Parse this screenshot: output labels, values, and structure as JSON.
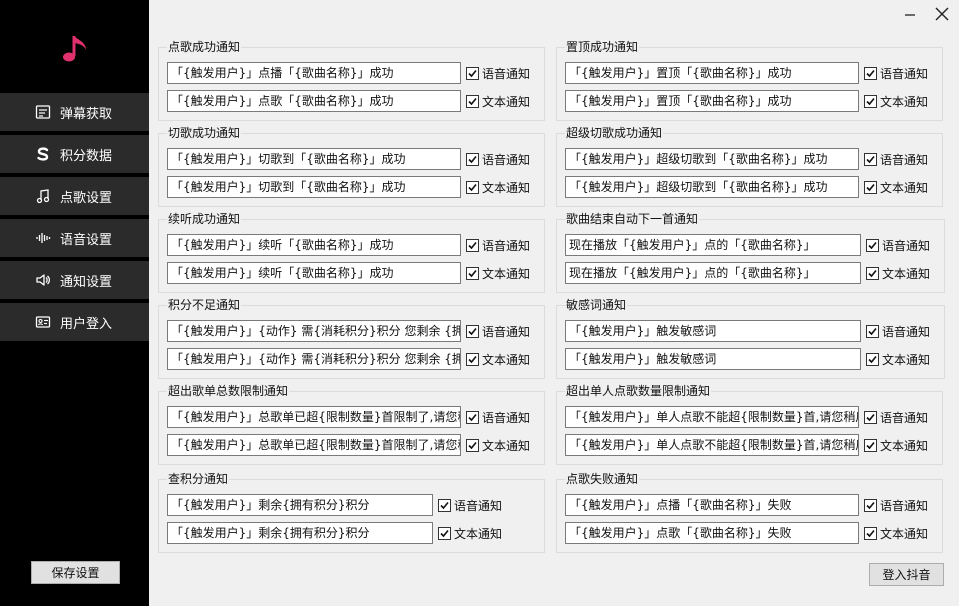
{
  "sidebar": {
    "items": [
      {
        "label": "弹幕获取",
        "icon": "barrage-icon"
      },
      {
        "label": "积分数据",
        "icon": "points-s-icon"
      },
      {
        "label": "点歌设置",
        "icon": "music-note-icon"
      },
      {
        "label": "语音设置",
        "icon": "waveform-icon"
      },
      {
        "label": "通知设置",
        "icon": "speaker-icon"
      },
      {
        "label": "用户登入",
        "icon": "id-card-icon"
      }
    ],
    "save_label": "保存设置"
  },
  "login_label": "登入抖音",
  "labels": {
    "voice": "语音通知",
    "text": "文本通知"
  },
  "colors": {
    "accent": "#e0306e",
    "sidebar_bg": "#000000",
    "nav_bg": "#2b2b2b"
  },
  "groups": [
    {
      "title": "点歌成功通知",
      "voice": "「{触发用户}」点播「{歌曲名称}」成功",
      "text": "「{触发用户}」点歌「{歌曲名称}」成功",
      "voice_checked": true,
      "text_checked": true
    },
    {
      "title": "置顶成功通知",
      "voice": "「{触发用户}」置顶「{歌曲名称}」成功",
      "text": "「{触发用户}」置顶「{歌曲名称}」成功",
      "voice_checked": true,
      "text_checked": true
    },
    {
      "title": "切歌成功通知",
      "voice": "「{触发用户}」切歌到「{歌曲名称}」成功",
      "text": "「{触发用户}」切歌到「{歌曲名称}」成功",
      "voice_checked": true,
      "text_checked": true
    },
    {
      "title": "超级切歌成功通知",
      "voice": "「{触发用户}」超级切歌到「{歌曲名称}」成功",
      "text": "「{触发用户}」超级切歌到「{歌曲名称}」成功",
      "voice_checked": true,
      "text_checked": true
    },
    {
      "title": "续听成功通知",
      "voice": "「{触发用户}」续听「{歌曲名称}」成功",
      "text": "「{触发用户}」续听「{歌曲名称}」成功",
      "voice_checked": true,
      "text_checked": true
    },
    {
      "title": "歌曲结束自动下一首通知",
      "voice": "现在播放「{触发用户}」点的「{歌曲名称}」",
      "text": "现在播放「{触发用户}」点的「{歌曲名称}」",
      "voice_checked": true,
      "text_checked": true
    },
    {
      "title": "积分不足通知",
      "voice": "「{触发用户}」{动作} 需{消耗积分}积分 您剩余 {拥",
      "text": "「{触发用户}」{动作} 需{消耗积分}积分 您剩余 {拥",
      "voice_checked": true,
      "text_checked": true
    },
    {
      "title": "敏感词通知",
      "voice": "「{触发用户}」触发敏感词",
      "text": "「{触发用户}」触发敏感词",
      "voice_checked": true,
      "text_checked": true
    },
    {
      "title": "超出歌单总数限制通知",
      "voice": "「{触发用户}」总歌单已超{限制数量}首限制了,请您稍",
      "text": "「{触发用户}」总歌单已超{限制数量}首限制了,请您稍",
      "voice_checked": true,
      "text_checked": true
    },
    {
      "title": "超出单人点歌数量限制通知",
      "voice": "「{触发用户}」单人点歌不能超{限制数量}首,请您稍后",
      "text": "「{触发用户}」单人点歌不能超{限制数量}首,请您稍后",
      "voice_checked": true,
      "text_checked": true
    },
    {
      "title": "查积分通知",
      "voice": "「{触发用户}」剩余{拥有积分}积分",
      "text": "「{触发用户}」剩余{拥有积分}积分",
      "voice_checked": true,
      "text_checked": true
    },
    {
      "title": "点歌失败通知",
      "voice": "「{触发用户}」点播「{歌曲名称}」失败",
      "text": "「{触发用户}」点歌「{歌曲名称}」失败",
      "voice_checked": true,
      "text_checked": true
    }
  ]
}
